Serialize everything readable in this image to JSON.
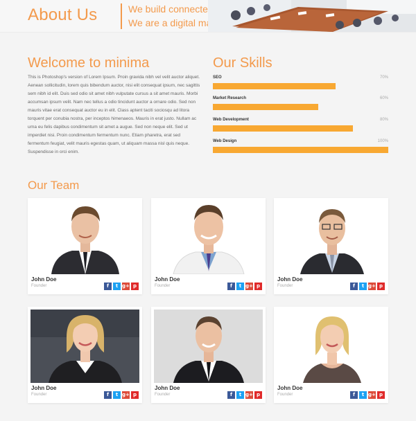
{
  "header": {
    "title": "About Us",
    "tagline_1": "We build connected",
    "tagline_2": "We are a digital marketing"
  },
  "welcome": {
    "title": "Welcome to minima",
    "body": "This is Photoshop's version of Lorem Ipsum. Proin gravida nibh vel velit auctor aliquet. Aenean sollicitudin, lorem quis bibendum auctor, nisi elit consequat ipsum, nec sagittis sem nibh id elit. Duis sed odio sit amet nibh vulputate cursus a sit amet mauris. Morbi accumsan ipsum velit. Nam nec tellus a odio tincidunt auctor a ornare odio. Sed non mauris vitae erat consequat auctor eu in elit. Class aptent taciti sociosqu ad litora torquent per conubia nostra, per inceptos himenaeos. Mauris in erat justo. Nullam ac urna eu felis dapibus condimentum sit amet a augue. Sed non neque elit. Sed ut imperdiet nisi. Proin condimentum fermentum nunc. Etiam pharetra, erat sed fermentum feugiat, velit mauris egestas quam, ut aliquam massa nisl quis neque. Suspendisse in orci enim."
  },
  "skills": {
    "title": "Our Skills",
    "items": [
      {
        "name": "SEO",
        "percent_label": "70%",
        "value": 70
      },
      {
        "name": "Market Research",
        "percent_label": "60%",
        "value": 60
      },
      {
        "name": "Web Development",
        "percent_label": "80%",
        "value": 80
      },
      {
        "name": "Web Design",
        "percent_label": "100%",
        "value": 100
      }
    ],
    "bar_color": "#f8a832"
  },
  "team": {
    "title": "Our Team",
    "members": [
      {
        "name": "John Doe",
        "role": "Founder"
      },
      {
        "name": "John Doe",
        "role": "Founder"
      },
      {
        "name": "John Doe",
        "role": "Founder"
      },
      {
        "name": "John Doe",
        "role": "Founder"
      },
      {
        "name": "John Doe",
        "role": "Founder"
      },
      {
        "name": "John Doe",
        "role": "Founder"
      }
    ],
    "social": [
      {
        "icon": "facebook-icon",
        "glyph": "f",
        "color": "#3b5998"
      },
      {
        "icon": "twitter-icon",
        "glyph": "t",
        "color": "#1da1f2"
      },
      {
        "icon": "google-plus-icon",
        "glyph": "g+",
        "color": "#dd4b39"
      },
      {
        "icon": "pinterest-icon",
        "glyph": "p",
        "color": "#e02a2a"
      }
    ]
  },
  "colors": {
    "accent": "#f39a4c",
    "background": "#f4f4f4"
  }
}
